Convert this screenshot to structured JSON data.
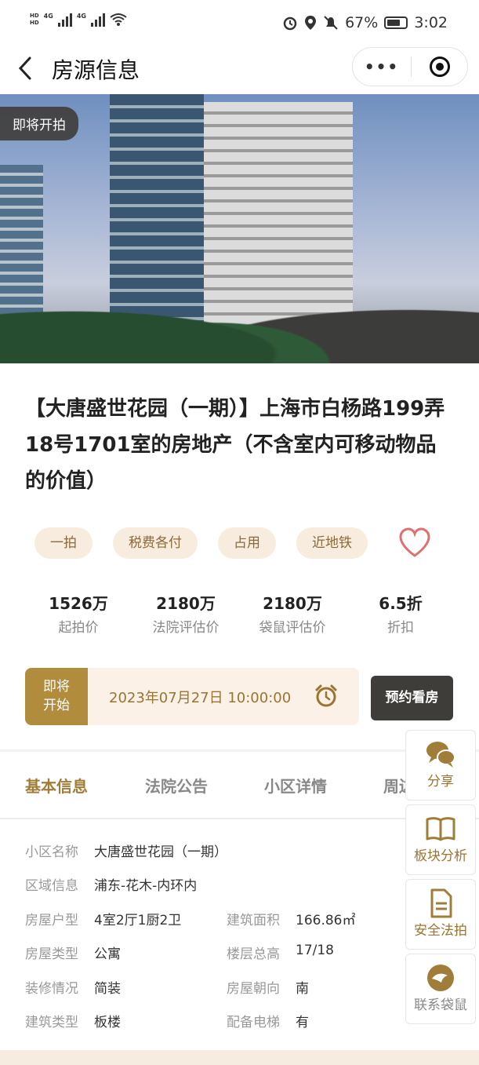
{
  "status": {
    "network_left": "HD 4G 4G",
    "battery_percent": "67%",
    "time": "3:02"
  },
  "nav": {
    "title": "房源信息",
    "more": "•••"
  },
  "photo": {
    "badge": "即将开拍"
  },
  "property": {
    "title": "【大唐盛世花园（一期）】上海市白杨路199弄18号1701室的房地产（不含室内可移动物品的价值）"
  },
  "tags": [
    "一拍",
    "税费各付",
    "占用",
    "近地铁"
  ],
  "stats": [
    {
      "value": "1526万",
      "label": "起拍价"
    },
    {
      "value": "2180万",
      "label": "法院评估价"
    },
    {
      "value": "2180万",
      "label": "袋鼠评估价"
    },
    {
      "value": "6.5折",
      "label": "折扣"
    }
  ],
  "auction": {
    "status_line1": "即将",
    "status_line2": "开始",
    "start_time": "2023年07月27日 10:00:00",
    "book_button": "预约看房"
  },
  "tabs": [
    "基本信息",
    "法院公告",
    "小区详情",
    "周边"
  ],
  "basic_info": {
    "community_name_label": "小区名称",
    "community_name": "大唐盛世花园（一期）",
    "area_label": "区域信息",
    "area": "浦东-花木-内环内",
    "layout_label": "房屋户型",
    "layout": "4室2厅1厨2卫",
    "build_area_label": "建筑面积",
    "build_area": "166.86㎡",
    "house_type_label": "房屋类型",
    "house_type": "公寓",
    "floors_label": "楼层总高",
    "floors": "17/18",
    "decoration_label": "装修情况",
    "decoration": "简装",
    "orientation_label": "房屋朝向",
    "orientation": "南",
    "building_type_label": "建筑类型",
    "building_type": "板楼",
    "elevator_label": "配备电梯",
    "elevator": "有"
  },
  "float_menu": {
    "share": "分享",
    "analysis": "板块分析",
    "safety": "安全法拍",
    "contact": "联系袋鼠"
  },
  "colors": {
    "accent": "#a07d38",
    "tag_bg": "#f7ecde",
    "dark_button": "#3f3d39",
    "heart": "#e07070"
  }
}
